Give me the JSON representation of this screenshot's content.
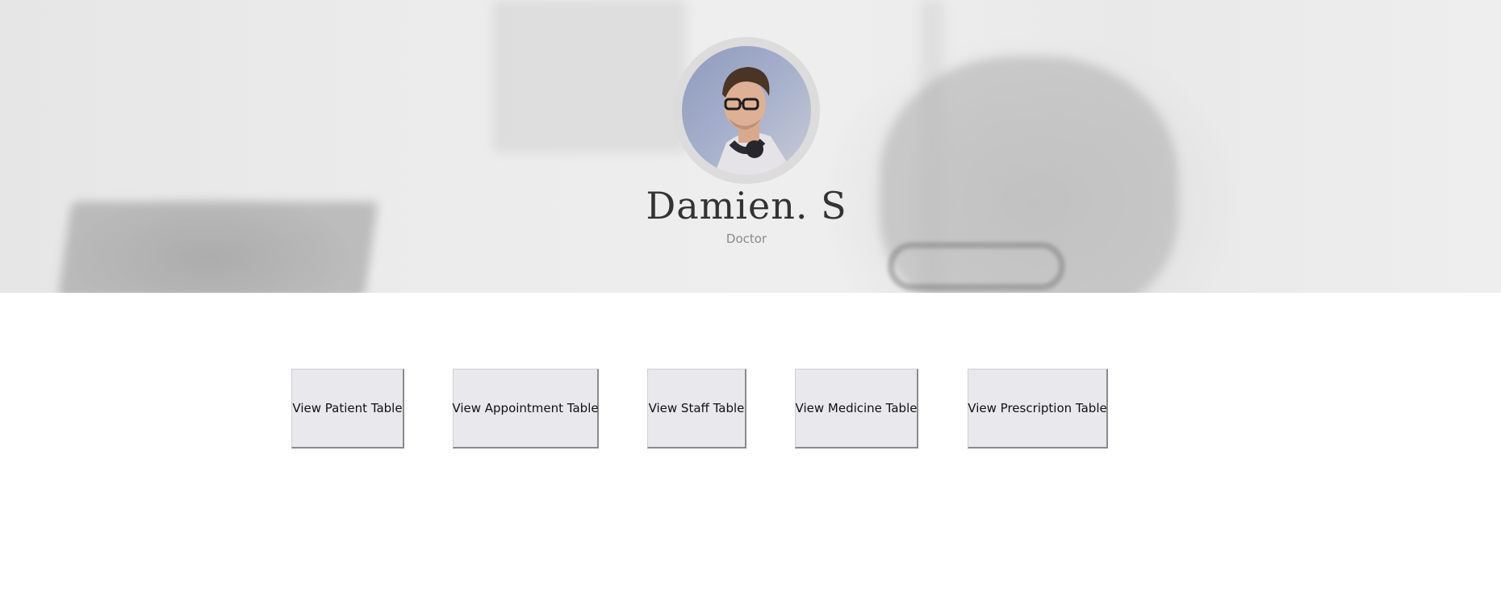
{
  "profile": {
    "name": "Damien. S",
    "role": "Doctor",
    "avatar_icon": "person-photo"
  },
  "actions": [
    {
      "label": "View Patient Table"
    },
    {
      "label": "View Appointment Table"
    },
    {
      "label": "View Staff Table"
    },
    {
      "label": "View Medicine Table"
    },
    {
      "label": "View Prescription Table"
    }
  ],
  "colors": {
    "button_bg": "#e9e8ec",
    "name_text": "#333333",
    "role_text": "#8a8a8a",
    "hero_bg": "#ececec"
  }
}
